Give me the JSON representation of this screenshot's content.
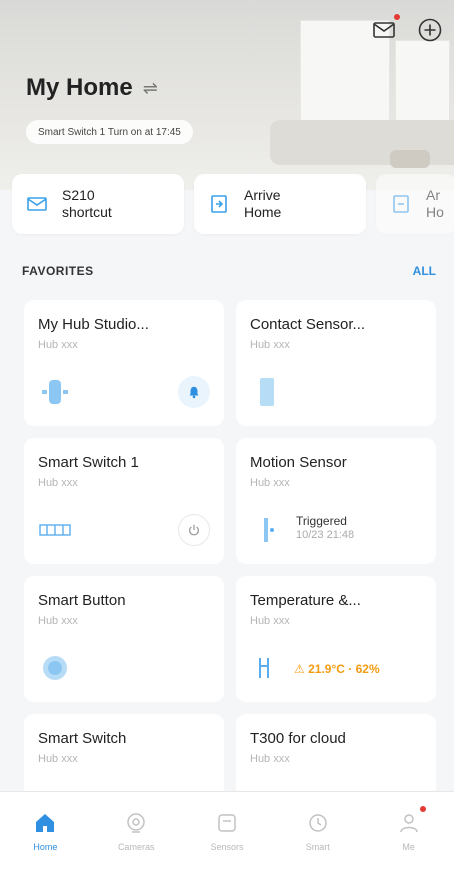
{
  "header": {
    "title": "My Home",
    "automation_text": "Smart Switch 1 Turn on at 17:45"
  },
  "shortcuts": [
    {
      "label": "S210\nshortcut"
    },
    {
      "label": "Arrive\nHome"
    },
    {
      "label": "Ar\nHo"
    }
  ],
  "favorites": {
    "title": "FAVORITES",
    "all_label": "ALL"
  },
  "devices": [
    {
      "name": "My Hub Studio...",
      "status": "Hub xxx"
    },
    {
      "name": "Contact Sensor...",
      "status": "Hub xxx"
    },
    {
      "name": "Smart Switch 1",
      "status": "Hub xxx"
    },
    {
      "name": "Motion Sensor",
      "status": "Hub xxx",
      "extra": "Triggered",
      "extra_time": "10/23 21:48"
    },
    {
      "name": "Smart Button",
      "status": "Hub xxx"
    },
    {
      "name": "Temperature &...",
      "status": "Hub xxx",
      "reading": "21.9°C · 62%"
    },
    {
      "name": "Smart Switch",
      "status": "Hub xxx"
    },
    {
      "name": "T300 for cloud",
      "status": "Hub xxx"
    }
  ],
  "tabs": [
    {
      "label": "Home"
    },
    {
      "label": "Cameras"
    },
    {
      "label": "Sensors"
    },
    {
      "label": "Smart"
    },
    {
      "label": "Me"
    }
  ],
  "colors": {
    "accent": "#2f8fe0",
    "warning": "#f39c12",
    "badge": "#e53935"
  }
}
